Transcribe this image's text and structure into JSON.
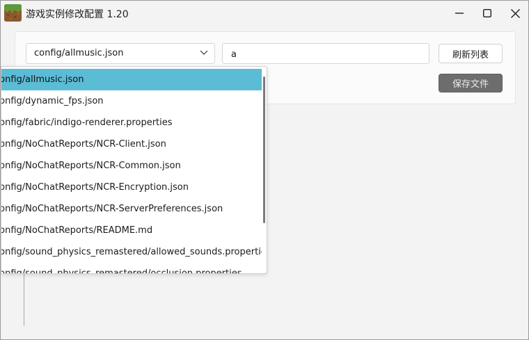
{
  "window": {
    "title": "游戏实例修改配置 1.20"
  },
  "toolbar": {
    "file_select_value": "config/allmusic.json",
    "search_value": "a",
    "refresh_label": "刷新列表",
    "save_label": "保存文件"
  },
  "dropdown": {
    "items": [
      "config/allmusic.json",
      "config/dynamic_fps.json",
      "config/fabric/indigo-renderer.properties",
      "config/NoChatReports/NCR-Client.json",
      "config/NoChatReports/NCR-Common.json",
      "config/NoChatReports/NCR-Encryption.json",
      "config/NoChatReports/NCR-ServerPreferences.json",
      "config/NoChatReports/README.md",
      "config/sound_physics_remastered/allowed_sounds.properties",
      "config/sound_physics_remastered/occlusion.properties"
    ],
    "selected_index": 0
  },
  "icons": {
    "app": "minecraft-grass-block-icon",
    "chevron": "chevron-down-icon",
    "minimize": "minimize-icon",
    "maximize": "maximize-icon",
    "close": "close-icon"
  },
  "colors": {
    "selected_item": "#5bbcd6",
    "save_button": "#6d6d6d",
    "window_bg": "#f3f3f3"
  }
}
